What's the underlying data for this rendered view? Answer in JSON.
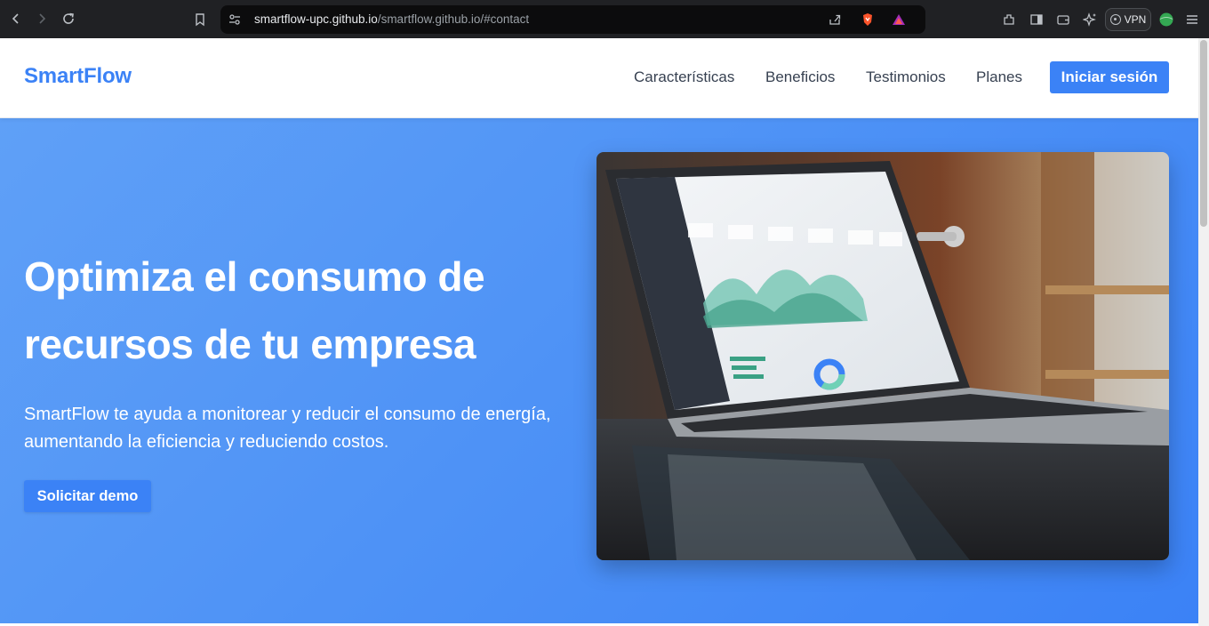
{
  "browser": {
    "url_host": "smartflow-upc.github.io",
    "url_path": "/smartflow.github.io/#contact",
    "vpn_label": "VPN",
    "icons": [
      "back-icon",
      "forward-icon",
      "reload-icon",
      "bookmark-icon",
      "site-settings-icon",
      "share-icon",
      "brave-shield-icon",
      "brave-rewards-icon",
      "extensions-icon",
      "sidebar-icon",
      "wallet-icon",
      "leo-ai-icon",
      "profile-icon",
      "menu-icon"
    ]
  },
  "header": {
    "brand": "SmartFlow",
    "nav": [
      "Características",
      "Beneficios",
      "Testimonios",
      "Planes"
    ],
    "login_label": "Iniciar sesión"
  },
  "hero": {
    "title": "Optimiza el consumo de recursos de tu empresa",
    "subtitle": "SmartFlow te ayuda a monitorear y reducir el consumo de energía, aumentando la eficiencia y reduciendo costos.",
    "cta_label": "Solicitar demo",
    "image_alt": "laptop-dashboard-photo"
  },
  "colors": {
    "accent": "#3b82f6",
    "hero_bg": "#4f93f6",
    "chrome_bg": "#202124"
  }
}
